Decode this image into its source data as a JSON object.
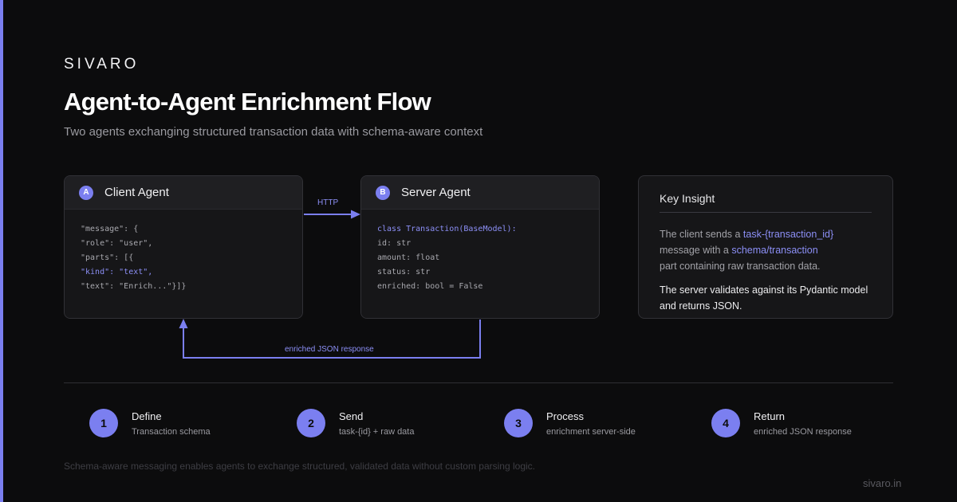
{
  "brand": "SIVARO",
  "title": "Agent-to-Agent Enrichment Flow",
  "subtitle": "Two agents exchanging structured transaction data with schema-aware context",
  "client": {
    "badge": "A",
    "title": "Client Agent",
    "code": [
      "\"message\": {",
      "\"role\": \"user\",",
      "\"parts\": [{",
      "\"kind\": \"text\",",
      "\"text\": \"Enrich...\"}]}"
    ]
  },
  "server": {
    "badge": "B",
    "title": "Server Agent",
    "code": [
      "class Transaction(BaseModel):",
      "id: str",
      "amount: float",
      "status: str",
      "enriched: bool = False"
    ]
  },
  "flow": {
    "request_label": "HTTP",
    "response_label": "enriched JSON response"
  },
  "insight": {
    "title": "Key Insight",
    "p1_pre": "The client sends a ",
    "p1_link1": "task-{transaction_id}",
    "p1_mid": " message with a ",
    "p1_link2": "schema/transaction",
    "p1_post": " part containing raw transaction data.",
    "p2": "The server validates against its Pydantic model and returns JSON."
  },
  "steps": [
    {
      "num": "1",
      "title": "Define",
      "sub": "Transaction schema"
    },
    {
      "num": "2",
      "title": "Send",
      "sub": "task-{id} + raw data"
    },
    {
      "num": "3",
      "title": "Process",
      "sub": "enrichment server-side"
    },
    {
      "num": "4",
      "title": "Return",
      "sub": "enriched JSON response"
    }
  ],
  "footnote": "Schema-aware messaging enables agents to exchange structured, validated data without custom parsing logic.",
  "site": "sivaro.in",
  "colors": {
    "accent": "#7b7ff0",
    "background": "#0c0c0d"
  }
}
